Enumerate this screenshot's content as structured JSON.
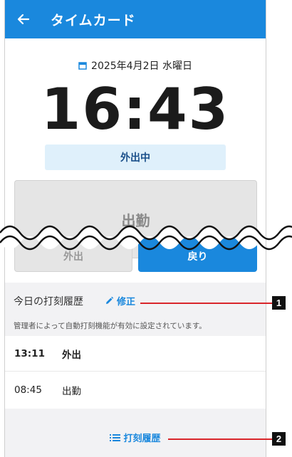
{
  "appbar": {
    "title": "タイムカード",
    "back_icon": "arrow-left-icon"
  },
  "clock": {
    "date": "2025年4月2日 水曜日",
    "time": "16:43"
  },
  "status": {
    "label": "外出中"
  },
  "buttons": {
    "clock_in": "出勤",
    "go_out": "外出",
    "return": "戻り"
  },
  "history": {
    "title": "今日の打刻履歴",
    "edit_label": "修正",
    "note": "管理者によって自動打刻機能が有効に設定されています。",
    "rows": [
      {
        "time": "13:11",
        "type": "外出"
      },
      {
        "time": "08:45",
        "type": "出勤"
      }
    ],
    "footer_label": "打刻履歴"
  },
  "callouts": [
    "1",
    "2"
  ],
  "colors": {
    "primary": "#1a88dd",
    "callout": "#d9252a"
  }
}
